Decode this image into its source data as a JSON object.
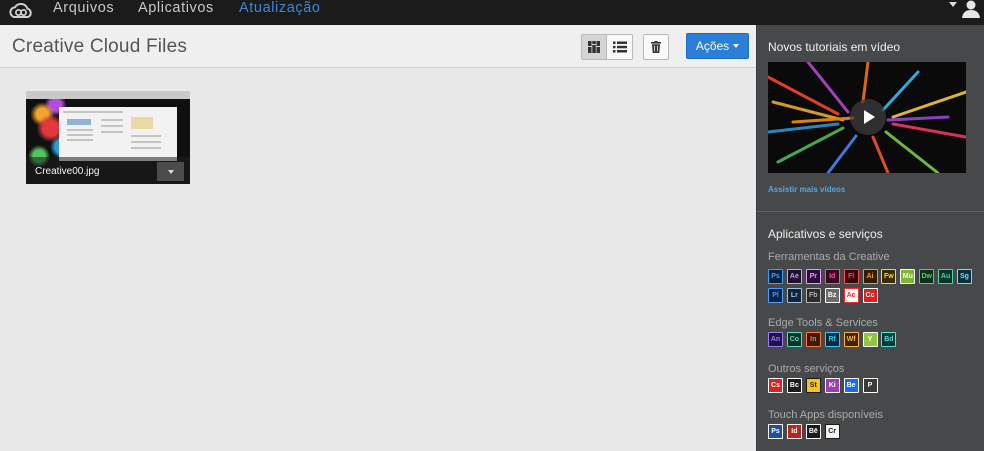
{
  "nav": {
    "items": [
      {
        "label": "Arquivos",
        "active": false
      },
      {
        "label": "Aplicativos",
        "active": false
      },
      {
        "label": "Atualização",
        "active": true
      }
    ]
  },
  "header": {
    "title": "Creative Cloud Files",
    "actions_label": "Ações",
    "view_modes": [
      "grid-view-icon",
      "list-view-icon"
    ],
    "selected_view": "grid"
  },
  "files": [
    {
      "name": "Creative00.jpg"
    }
  ],
  "sidebar": {
    "tutorials_heading": "Novos tutoriais em vídeo",
    "more_videos_link": "Assistir mais vídeos",
    "apps_heading": "Aplicativos e serviços",
    "groups": [
      {
        "title": "Ferramentas da Creative",
        "rows": [
          [
            {
              "abbr": "Ps",
              "color": "#31a8ff",
              "bg": "#0c1e3d"
            },
            {
              "abbr": "Ae",
              "color": "#d39cff",
              "bg": "#20102e"
            },
            {
              "abbr": "Pr",
              "color": "#e89cff",
              "bg": "#2a0d3a"
            },
            {
              "abbr": "Id",
              "color": "#ff4fa0",
              "bg": "#3a0520"
            },
            {
              "abbr": "Fl",
              "color": "#ff4a4a",
              "bg": "#3a0606"
            },
            {
              "abbr": "Ai",
              "color": "#ff9a00",
              "bg": "#331c00"
            },
            {
              "abbr": "Fw",
              "color": "#ffd33a",
              "bg": "#3a2d00"
            },
            {
              "abbr": "Mu",
              "color": "#ffffff",
              "bg": "#7db72f"
            },
            {
              "abbr": "Dw",
              "color": "#4ad36b",
              "bg": "#0d3316"
            },
            {
              "abbr": "Au",
              "color": "#46d9b0",
              "bg": "#063326"
            },
            {
              "abbr": "Sg",
              "color": "#7fd7ff",
              "bg": "#05303d"
            }
          ],
          [
            {
              "abbr": "Pl",
              "color": "#4a9cff",
              "bg": "#0a2147"
            },
            {
              "abbr": "Lr",
              "color": "#9bc4e8",
              "bg": "#142335"
            },
            {
              "abbr": "Fb",
              "color": "#b8b8b8",
              "bg": "#2b2b2b"
            },
            {
              "abbr": "Bz",
              "color": "#ffffff",
              "bg": "#6b6b6b"
            },
            {
              "abbr": "Ac",
              "color": "#ff2a2a",
              "bg": "#ffffff"
            },
            {
              "abbr": "Cc",
              "color": "#ffffff",
              "bg": "#e0201e"
            }
          ]
        ]
      },
      {
        "title": "Edge Tools & Services",
        "rows": [
          [
            {
              "abbr": "An",
              "color": "#9c7cff",
              "bg": "#1e1347"
            },
            {
              "abbr": "Co",
              "color": "#4fe0c0",
              "bg": "#0a3328"
            },
            {
              "abbr": "In",
              "color": "#ff7a33",
              "bg": "#3a1a08"
            },
            {
              "abbr": "Rf",
              "color": "#33c6ff",
              "bg": "#062a3a"
            },
            {
              "abbr": "Wf",
              "color": "#ffb347",
              "bg": "#3a2608"
            },
            {
              "abbr": "Y",
              "color": "#ffffff",
              "bg": "#8dc63f"
            },
            {
              "abbr": "Bd",
              "color": "#4de2d6",
              "bg": "#063a36"
            }
          ]
        ]
      },
      {
        "title": "Outros serviços",
        "rows": [
          [
            {
              "abbr": "Cs",
              "color": "#ffffff",
              "bg": "#e0201e"
            },
            {
              "abbr": "Bc",
              "color": "#ffffff",
              "bg": "#1b1b1b"
            },
            {
              "abbr": "St",
              "color": "#1b1b1b",
              "bg": "#f7c516"
            },
            {
              "abbr": "Ki",
              "color": "#ffffff",
              "bg": "#a23cb0"
            },
            {
              "abbr": "Be",
              "color": "#ffffff",
              "bg": "#1769ff"
            },
            {
              "abbr": "P",
              "color": "#ffffff",
              "bg": "#3a3a3a"
            }
          ]
        ]
      },
      {
        "title": "Touch Apps disponíveis",
        "rows": [
          [
            {
              "abbr": "Ps",
              "color": "#ffffff",
              "bg": "#1b4fa8"
            },
            {
              "abbr": "Id",
              "color": "#ffffff",
              "bg": "#b8261e"
            },
            {
              "abbr": "Bē",
              "color": "#ffffff",
              "bg": "#1b1b1b"
            },
            {
              "abbr": "Cr",
              "color": "#1b1b1b",
              "bg": "#f2f2f2"
            }
          ]
        ]
      }
    ]
  }
}
